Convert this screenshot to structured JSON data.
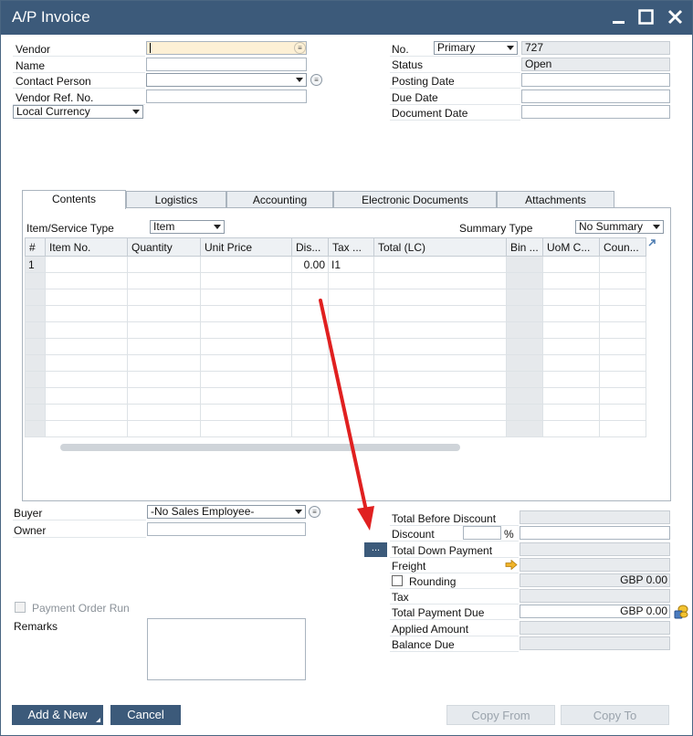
{
  "window": {
    "title": "A/P Invoice"
  },
  "header_left": {
    "vendor_label": "Vendor",
    "name_label": "Name",
    "contact_person_label": "Contact Person",
    "vendor_ref_label": "Vendor Ref. No.",
    "currency_value": "Local Currency"
  },
  "header_right": {
    "no_label": "No.",
    "series_value": "Primary",
    "doc_number": "727",
    "status_label": "Status",
    "status_value": "Open",
    "posting_date_label": "Posting Date",
    "due_date_label": "Due Date",
    "document_date_label": "Document Date"
  },
  "tabs": [
    {
      "label": "Contents"
    },
    {
      "label": "Logistics"
    },
    {
      "label": "Accounting"
    },
    {
      "label": "Electronic Documents"
    },
    {
      "label": "Attachments"
    }
  ],
  "contents": {
    "item_type_label": "Item/Service Type",
    "item_type_value": "Item",
    "summary_type_label": "Summary Type",
    "summary_type_value": "No Summary",
    "columns": [
      "#",
      "Item No.",
      "Quantity",
      "Unit Price",
      "Dis...",
      "Tax ...",
      "Total (LC)",
      "Bin ...",
      "UoM C...",
      "Coun..."
    ],
    "row1": {
      "num": "1",
      "discount": "0.00",
      "tax": "I1"
    }
  },
  "footer_left": {
    "buyer_label": "Buyer",
    "buyer_value": "-No Sales Employee-",
    "owner_label": "Owner",
    "payment_order_run_label": "Payment Order Run",
    "remarks_label": "Remarks"
  },
  "totals": {
    "total_before_discount_label": "Total Before Discount",
    "discount_label": "Discount",
    "percent_sign": "%",
    "total_down_payment_label": "Total Down Payment",
    "down_payment_button": "...",
    "freight_label": "Freight",
    "rounding_label": "Rounding",
    "rounding_value": "GBP 0.00",
    "tax_label": "Tax",
    "total_payment_due_label": "Total Payment Due",
    "total_payment_due_value": "GBP 0.00",
    "applied_amount_label": "Applied Amount",
    "balance_due_label": "Balance Due"
  },
  "buttons": {
    "add_new": "Add & New",
    "cancel": "Cancel",
    "copy_from": "Copy From",
    "copy_to": "Copy To"
  },
  "colors": {
    "titlebar": "#3c5a7a",
    "annotation_arrow": "#e02020",
    "readonly_field": "#e8ebee"
  }
}
